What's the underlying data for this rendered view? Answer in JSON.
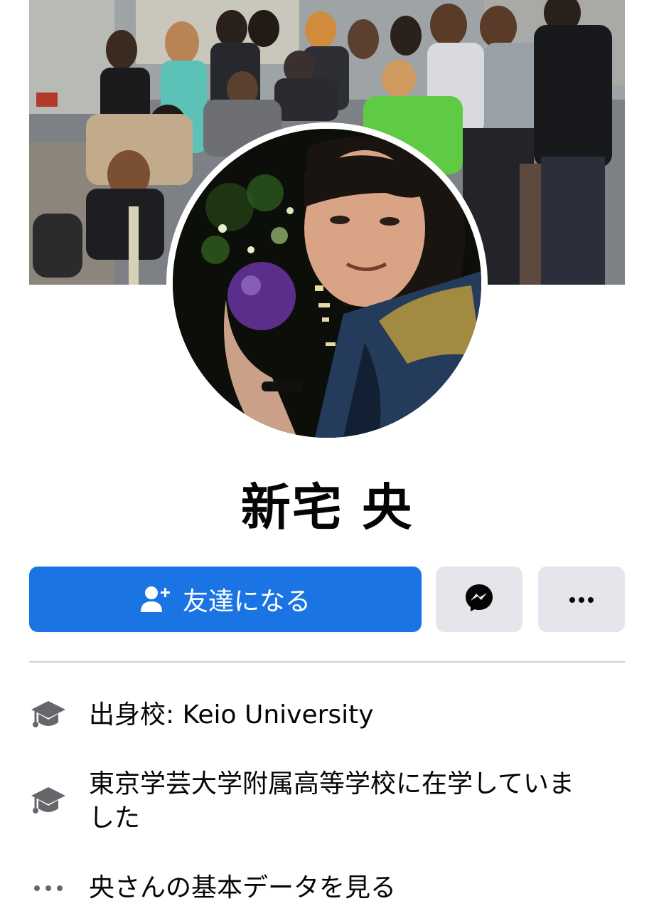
{
  "profile": {
    "name": "新宅 央",
    "cover_photo": "group-photo",
    "avatar_photo": "profile-photo"
  },
  "actions": {
    "add_friend_label": "友達になる",
    "add_friend_icon": "add-friend-icon",
    "messenger_icon": "messenger-icon",
    "more_icon": "more-dots-icon"
  },
  "intro": {
    "items": [
      {
        "icon": "education-icon",
        "text": "出身校: Keio University"
      },
      {
        "icon": "education-icon",
        "text": "東京学芸大学附属高等学校に在学していました"
      },
      {
        "icon": "more-dots-icon",
        "text": "央さんの基本データを見る"
      }
    ]
  },
  "colors": {
    "primary": "#1b74e4",
    "secondary_button": "#e4e6eb",
    "text": "#050505",
    "icon_gray": "#65676b",
    "divider": "#ced0d4"
  }
}
